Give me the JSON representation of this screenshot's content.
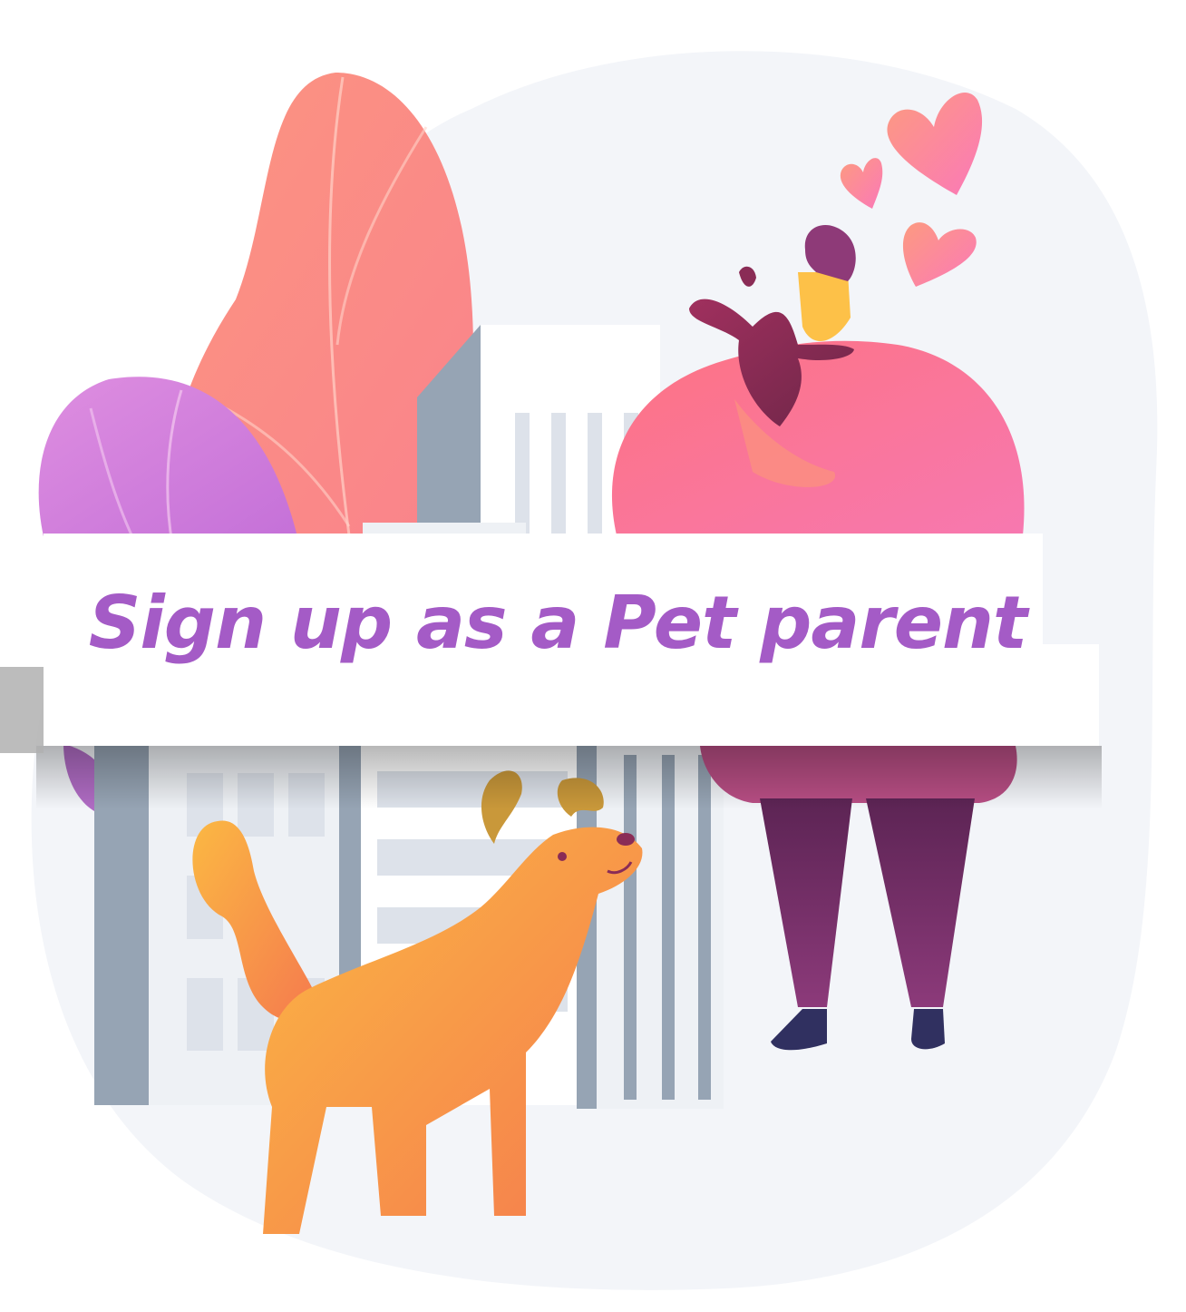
{
  "banner": {
    "label": "Sign up as a Pet parent"
  },
  "colors": {
    "background_blob": "#f3f5f9",
    "banner_text": "#a45bc6",
    "banner_fill": "#ffffff",
    "tall_leaf": "#f98e80",
    "small_leaf": "#d98ae0",
    "building_shade": "#96a4b4",
    "building_light": "#eef1f5",
    "person_shirt": "#fc7d96",
    "person_pants": "#74306c",
    "person_skin": "#fdc148",
    "person_hair": "#8e3a78",
    "small_dog": "#8a2c56",
    "hearts": "#fb8a90",
    "dog_body": "#f8a040",
    "shoes": "#303060"
  },
  "icons": {
    "hearts": "heart-icon",
    "person": "person-hugging-pet-illustration",
    "dog": "dog-illustration"
  }
}
